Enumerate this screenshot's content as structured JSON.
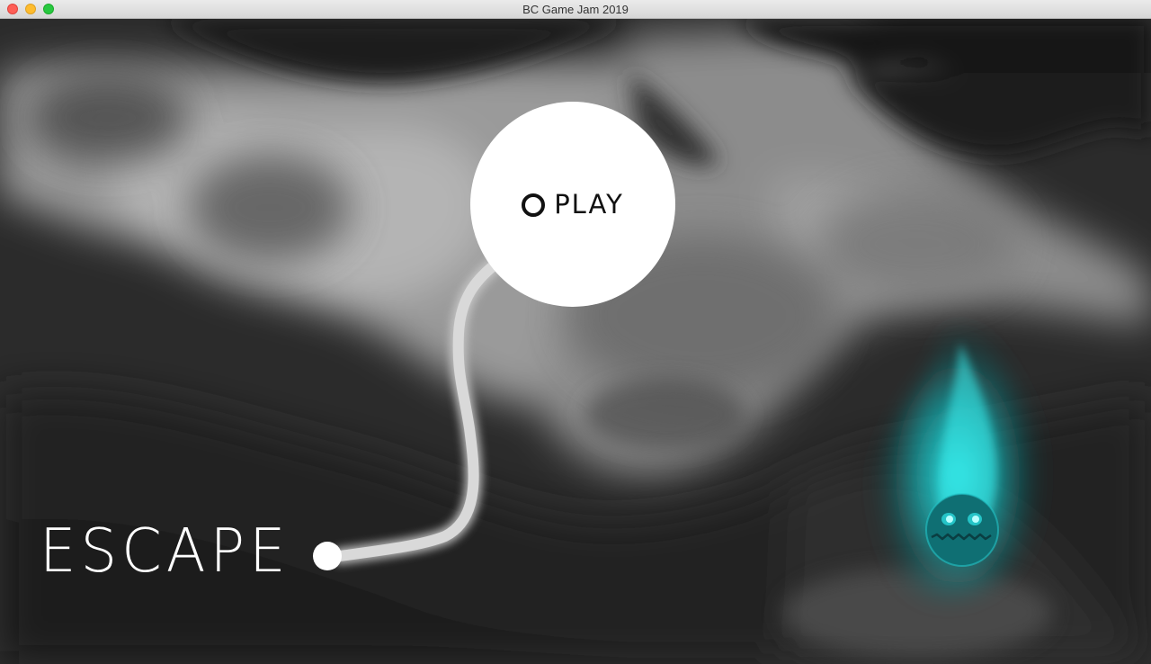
{
  "window": {
    "title": "BC Game Jam 2019"
  },
  "game": {
    "title": "ESCAPE",
    "play_label": "PLAY"
  },
  "colors": {
    "accent_glow": "#1fd6d6",
    "monster_body": "#0f6f73",
    "button": "#ffffff"
  },
  "icons": {
    "play": "ring-icon",
    "character": "cyan-monster-icon"
  }
}
